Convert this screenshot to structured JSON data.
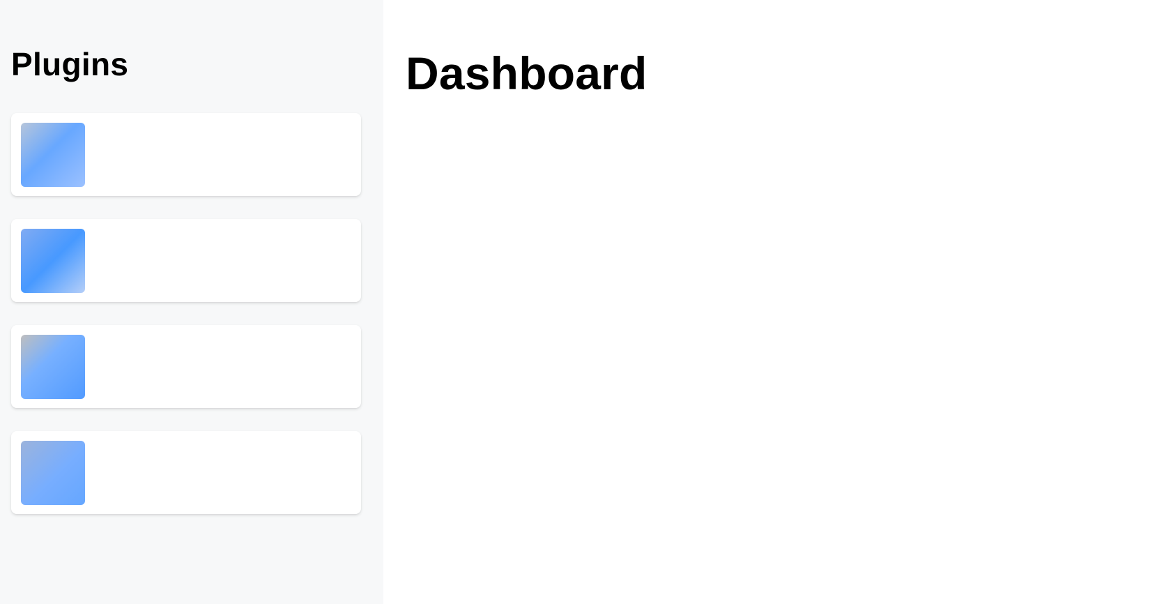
{
  "sidebar": {
    "title": "Plugins",
    "plugins": [
      {
        "label": ""
      },
      {
        "label": ""
      },
      {
        "label": ""
      },
      {
        "label": ""
      }
    ]
  },
  "main": {
    "title": "Dashboard",
    "info_heading": "",
    "info_text": "",
    "info_link": ""
  },
  "colors": {
    "sidebar_bg": "#f7f8f9",
    "accent": "#4a97ff",
    "card_bg": "#ffffff"
  }
}
